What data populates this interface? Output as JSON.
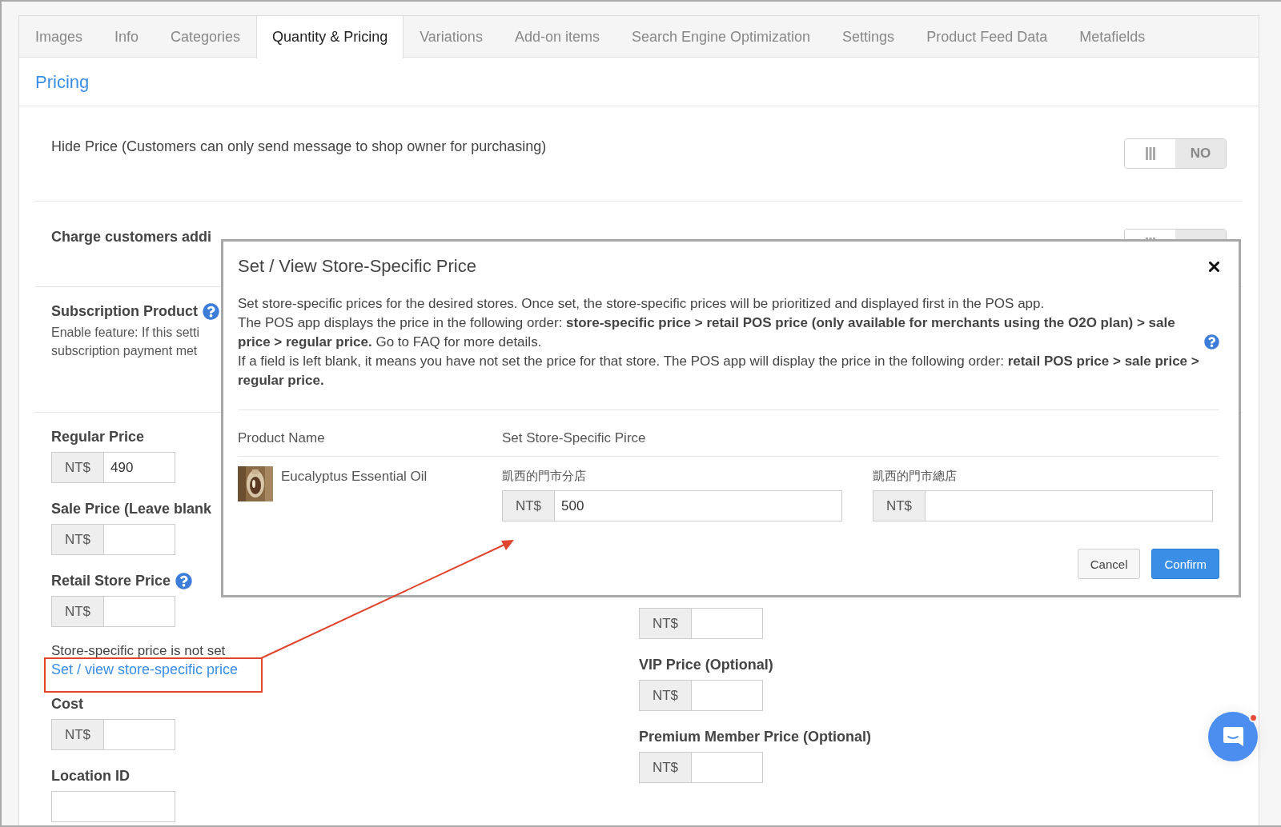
{
  "tabs": [
    {
      "label": "Images",
      "selected": false
    },
    {
      "label": "Info",
      "selected": false
    },
    {
      "label": "Categories",
      "selected": false
    },
    {
      "label": "Quantity & Pricing",
      "selected": true
    },
    {
      "label": "Variations",
      "selected": false
    },
    {
      "label": "Add-on items",
      "selected": false
    },
    {
      "label": "Search Engine Optimization",
      "selected": false
    },
    {
      "label": "Settings",
      "selected": false
    },
    {
      "label": "Product Feed Data",
      "selected": false
    },
    {
      "label": "Metafields",
      "selected": false
    }
  ],
  "section_title": "Pricing",
  "hide_price": {
    "label": "Hide Price (Customers can only send message to shop owner for purchasing)",
    "toggle_on": false,
    "toggle_label": "NO"
  },
  "consumption_tax": {
    "label": "Charge customers addi",
    "toggle_on": false
  },
  "subscription": {
    "label": "Subscription Product",
    "description_lines": [
      "Enable feature: If this setti",
      "subscription payment met"
    ]
  },
  "left_fields": [
    {
      "kind": "price",
      "label": "Regular Price",
      "prefix": "NT$",
      "value": "490"
    },
    {
      "kind": "price",
      "label": "Sale Price (Leave blank",
      "prefix": "NT$"
    },
    {
      "kind": "price",
      "label": "Retail Store Price",
      "help": true,
      "prefix": "NT$"
    },
    {
      "kind": "note",
      "text": "Store-specific price is not set",
      "link": "Set / view store-specific price"
    },
    {
      "kind": "price",
      "label": "Cost",
      "prefix": "NT$"
    },
    {
      "kind": "plain",
      "label": "Location ID"
    }
  ],
  "right_fields": [
    {
      "kind": "price",
      "prefix": "NT$"
    },
    {
      "kind": "price",
      "label": "VIP Price (Optional)",
      "prefix": "NT$"
    },
    {
      "kind": "price",
      "label": "Premium Member Price (Optional)",
      "prefix": "NT$"
    }
  ],
  "modal": {
    "title": "Set / View Store-Specific Price",
    "paragraphs": [
      {
        "text": "Set store-specific prices for the desired stores. Once set, the store-specific prices will be prioritized and displayed first in the POS app."
      },
      {
        "text": "The POS app displays the price in the following order: **store-specific price > retail POS price (only available for merchants using the O2O plan) > sale price > regular price.** Go to FAQ for more details.",
        "help": true
      },
      {
        "text": "If a field is left blank, it means you have not set the price for that store. The POS app will display the price in the following order: **retail POS price > sale price > regular price.**"
      }
    ],
    "columns": [
      "Product Name",
      "Set Store-Specific Pirce"
    ],
    "product": {
      "name": "Eucalyptus Essential Oil",
      "stores": [
        {
          "name": "凱西的門市分店",
          "prefix": "NT$",
          "value": "500"
        },
        {
          "name": "凱西的門市總店",
          "prefix": "NT$"
        }
      ]
    },
    "buttons": [
      {
        "label": "Cancel",
        "kind": "secondary"
      },
      {
        "label": "Confirm",
        "kind": "primary"
      }
    ]
  },
  "chat": {
    "unread": true
  }
}
